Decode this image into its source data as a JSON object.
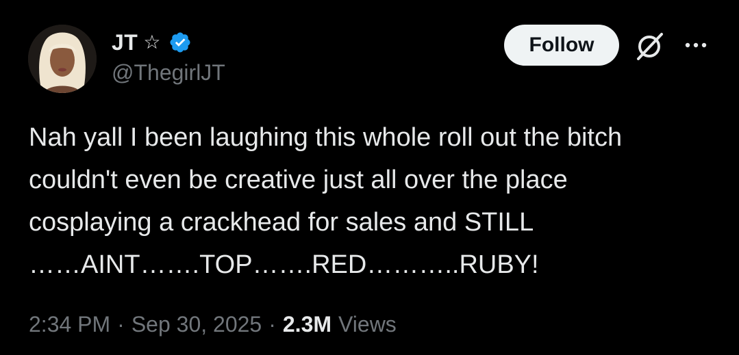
{
  "author": {
    "display_name": "JT",
    "star_glyph": "☆",
    "handle": "@ThegirlJT",
    "verified": true,
    "verified_color": "#1d9bf0",
    "avatar_icon": "avatar-photo"
  },
  "actions": {
    "follow_label": "Follow",
    "grok_icon": "grok-icon",
    "more_icon": "more-options-icon"
  },
  "tweet": {
    "lines": [
      "Nah yall I been laughing this whole roll out the bitch",
      "couldn't even be creative just all over the place",
      "cosplaying a crackhead for sales and STILL",
      "……AINT…….TOP…….RED………..RUBY!"
    ]
  },
  "meta": {
    "time": "2:34 PM",
    "separator": "·",
    "date": "Sep 30, 2025",
    "views_count": "2.3M",
    "views_label": "Views"
  },
  "colors": {
    "background": "#000000",
    "text": "#e7e9ea",
    "secondary": "#71767b",
    "follow_bg": "#eff3f4"
  }
}
